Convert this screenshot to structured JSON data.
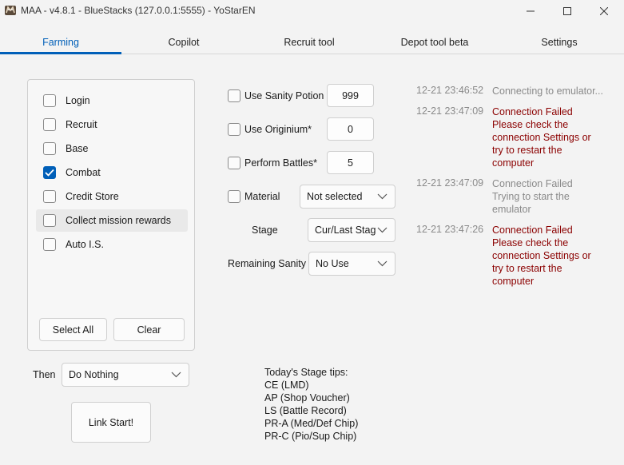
{
  "window": {
    "title": "MAA - v4.8.1 - BlueStacks (127.0.0.1:5555) - YoStarEN",
    "minimize_icon": "minimize-icon",
    "maximize_icon": "maximize-icon",
    "close_icon": "close-icon"
  },
  "tabs": [
    {
      "label": "Farming",
      "active": true
    },
    {
      "label": "Copilot",
      "active": false
    },
    {
      "label": "Recruit tool",
      "active": false
    },
    {
      "label": "Depot tool beta",
      "active": false
    },
    {
      "label": "Settings",
      "active": false
    }
  ],
  "tasks": [
    {
      "label": "Login",
      "checked": false
    },
    {
      "label": "Recruit",
      "checked": false
    },
    {
      "label": "Base",
      "checked": false
    },
    {
      "label": "Combat",
      "checked": true
    },
    {
      "label": "Credit Store",
      "checked": false
    },
    {
      "label": "Collect mission rewards",
      "checked": false
    },
    {
      "label": "Auto I.S.",
      "checked": false
    }
  ],
  "task_buttons": {
    "select_all": "Select All",
    "clear": "Clear"
  },
  "options": {
    "sanity_potion": {
      "label": "Use Sanity Potion",
      "value": "999",
      "checked": false
    },
    "originium": {
      "label": "Use Originium*",
      "value": "0",
      "checked": false
    },
    "battles": {
      "label": "Perform Battles*",
      "value": "5",
      "checked": false
    },
    "material": {
      "label": "Material",
      "value": "Not selected",
      "checked": false
    },
    "stage": {
      "label": "Stage",
      "value": "Cur/Last Stag"
    },
    "remaining_sanity": {
      "label": "Remaining Sanity",
      "value": "No Use"
    }
  },
  "then": {
    "label": "Then",
    "value": "Do Nothing"
  },
  "link_start": "Link Start!",
  "stage_tips": {
    "heading": "Today's Stage tips:",
    "lines": [
      "CE (LMD)",
      "AP (Shop Voucher)",
      "LS (Battle Record)",
      "PR-A (Med/Def Chip)",
      "PR-C (Pio/Sup Chip)"
    ]
  },
  "log": [
    {
      "time": "12-21  23:46:52",
      "lines": [
        "Connecting to emulator..."
      ],
      "level": "info"
    },
    {
      "time": "12-21  23:47:09",
      "lines": [
        "Connection Failed",
        "Please check the",
        "connection Settings or",
        "try to restart the",
        "computer"
      ],
      "level": "error"
    },
    {
      "time": "12-21  23:47:09",
      "lines": [
        "Connection Failed",
        "Trying to start the",
        "emulator"
      ],
      "level": "info"
    },
    {
      "time": "12-21  23:47:26",
      "lines": [
        "Connection Failed",
        "Please check the",
        "connection Settings or",
        "try to restart the",
        "computer"
      ],
      "level": "error"
    }
  ],
  "colors": {
    "accent": "#005fb8",
    "error": "#8b0000",
    "muted": "#8a8a8a"
  }
}
